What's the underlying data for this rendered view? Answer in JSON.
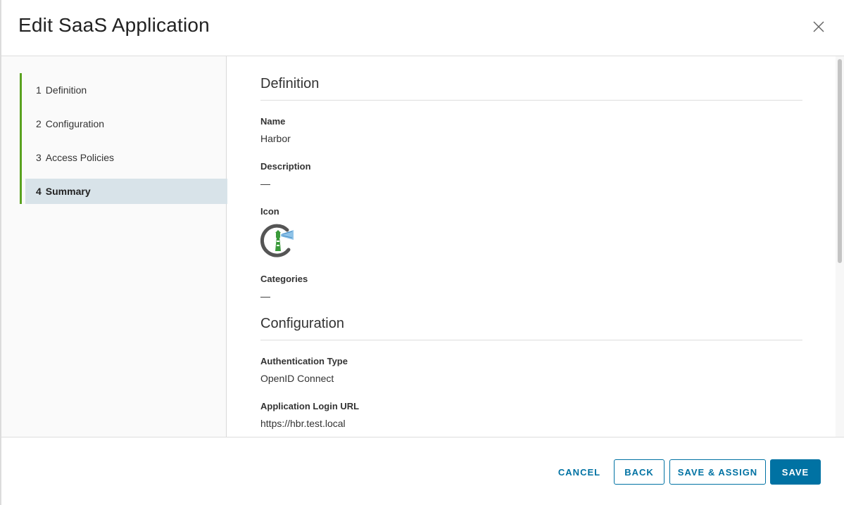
{
  "modal": {
    "title": "Edit SaaS Application"
  },
  "steps": [
    {
      "num": "1",
      "label": "Definition"
    },
    {
      "num": "2",
      "label": "Configuration"
    },
    {
      "num": "3",
      "label": "Access Policies"
    },
    {
      "num": "4",
      "label": "Summary"
    }
  ],
  "summary": {
    "definition": {
      "title": "Definition",
      "name_label": "Name",
      "name_value": "Harbor",
      "description_label": "Description",
      "description_value": "—",
      "icon_label": "Icon",
      "categories_label": "Categories",
      "categories_value": "—"
    },
    "configuration": {
      "title": "Configuration",
      "auth_type_label": "Authentication Type",
      "auth_type_value": "OpenID Connect",
      "login_url_label": "Application Login URL",
      "login_url_value": "https://hbr.test.local"
    }
  },
  "footer": {
    "cancel": "CANCEL",
    "back": "BACK",
    "save_assign": "SAVE & ASSIGN",
    "save": "SAVE"
  },
  "colors": {
    "accent": "#0072a3",
    "step_bar": "#5aa220",
    "active_step_bg": "#d8e3e9"
  }
}
